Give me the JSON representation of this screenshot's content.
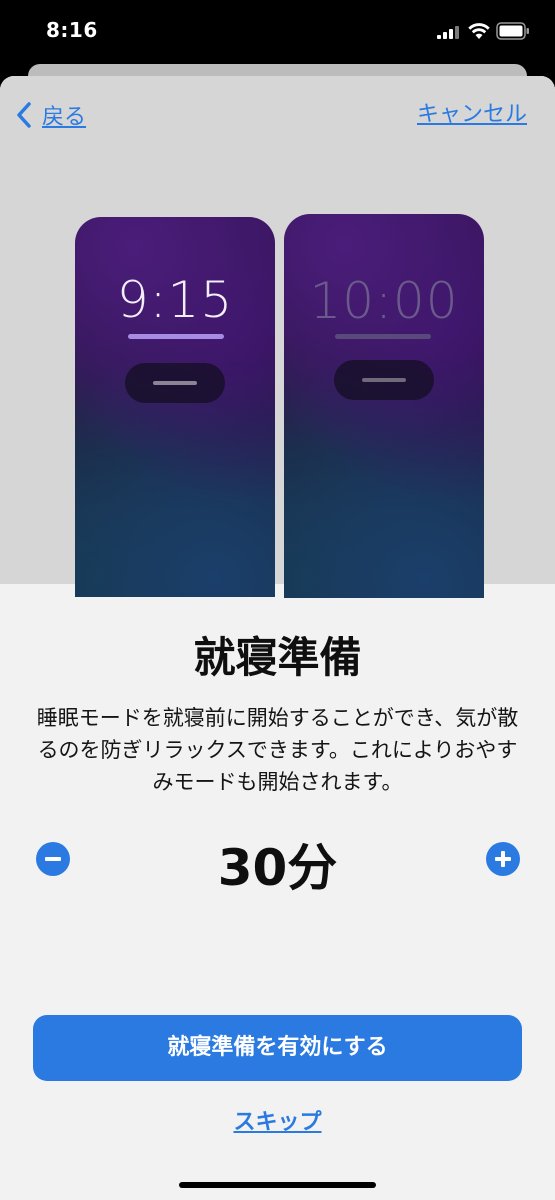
{
  "status_bar": {
    "time": "8:16"
  },
  "nav": {
    "back_label": "戻る",
    "cancel_label": "キャンセル"
  },
  "preview": {
    "left_time": "9:15",
    "right_time": "10:00"
  },
  "content": {
    "title": "就寝準備",
    "description": "睡眠モードを就寝前に開始することができ、気が散るのを防ぎリラックスできます。これによりおやすみモードも開始されます。",
    "duration": "30分"
  },
  "actions": {
    "enable_label": "就寝準備を有効にする",
    "skip_label": "スキップ"
  },
  "colors": {
    "accent": "#2a7ae2"
  }
}
